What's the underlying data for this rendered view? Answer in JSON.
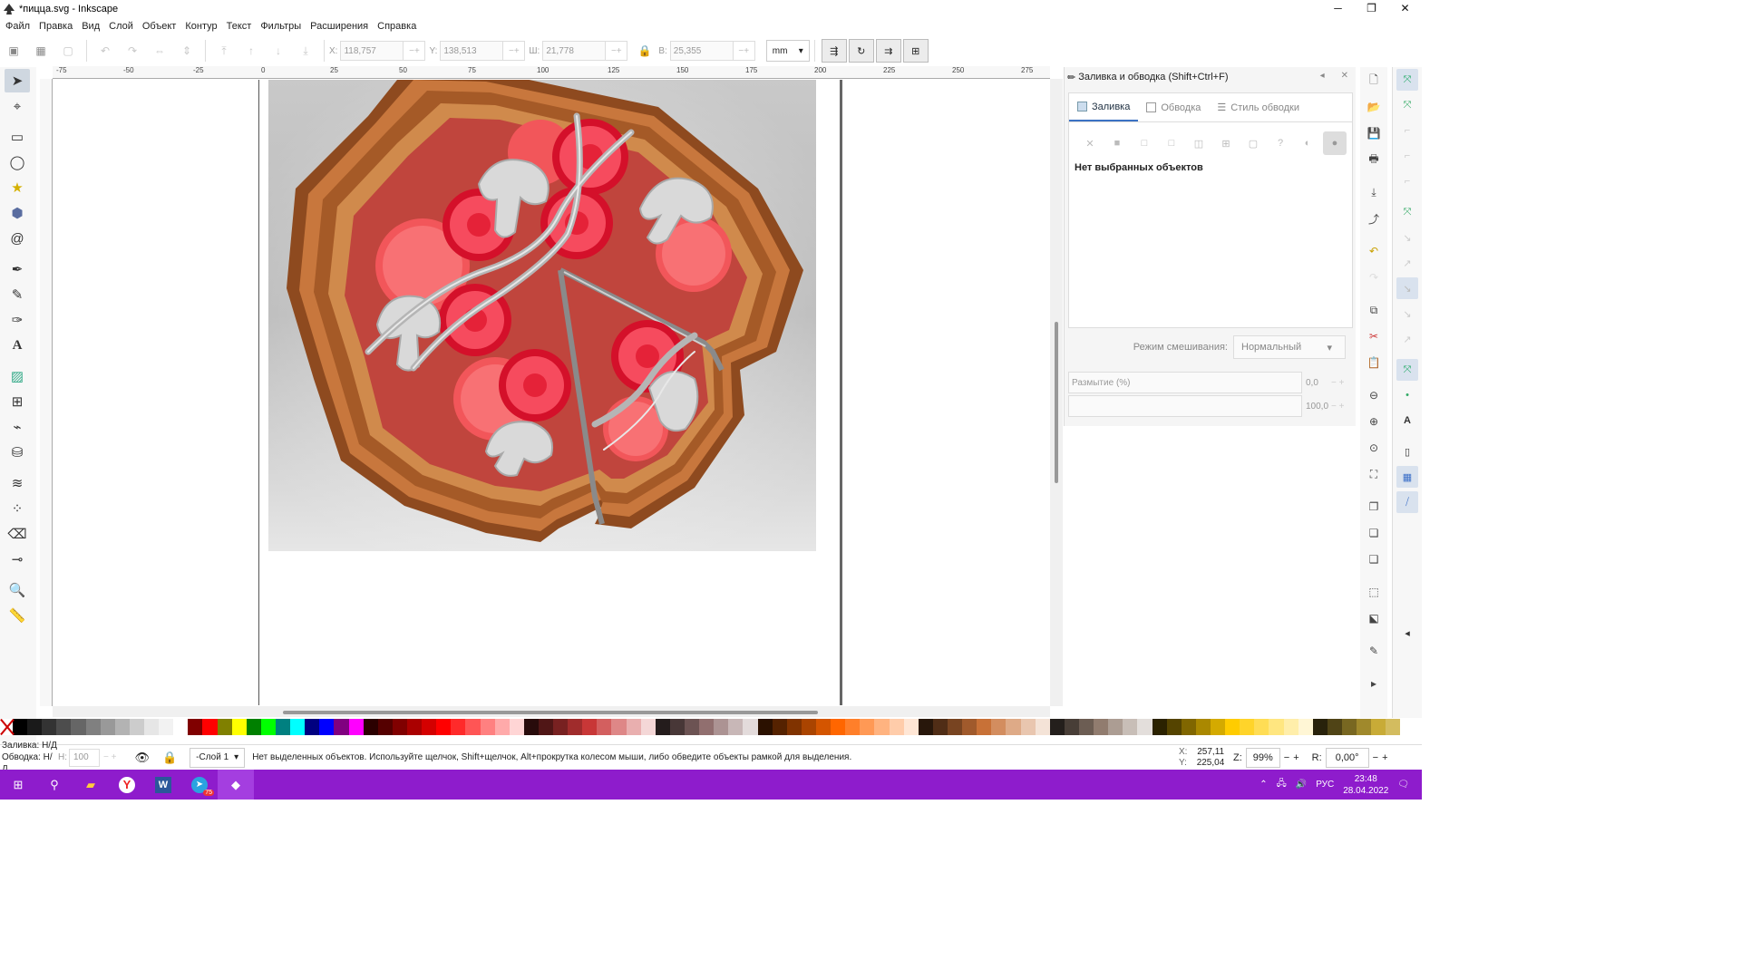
{
  "window": {
    "title": "*пицца.svg - Inkscape",
    "minimize": "─",
    "maximize": "❐",
    "close": "✕"
  },
  "menu": [
    "Файл",
    "Правка",
    "Вид",
    "Слой",
    "Объект",
    "Контур",
    "Текст",
    "Фильтры",
    "Расширения",
    "Справка"
  ],
  "toolbar": {
    "x_label": "X:",
    "x_value": "118,757",
    "y_label": "Y:",
    "y_value": "138,513",
    "w_label": "Ш:",
    "w_value": "21,778",
    "h_label": "В:",
    "h_value": "25,355",
    "unit": "mm"
  },
  "ruler": {
    "h_ticks": [
      "-75",
      "-50",
      "-25",
      "0",
      "25",
      "50",
      "75",
      "100",
      "125",
      "150",
      "175",
      "200",
      "225",
      "250",
      "275"
    ]
  },
  "dock": {
    "title": "Заливка и обводка (Shift+Ctrl+F)",
    "tabs": [
      "Заливка",
      "Обводка",
      "Стиль обводки"
    ],
    "no_selection": "Нет выбранных объектов",
    "blend_label": "Режим смешивания:",
    "blend_value": "Нормальный",
    "blur_label": "Размытие (%)",
    "blur_value": "0,0",
    "opacity_value": "100,0"
  },
  "palette": [
    "#000000",
    "#1a1a1a",
    "#333333",
    "#4d4d4d",
    "#666666",
    "#808080",
    "#999999",
    "#b3b3b3",
    "#cccccc",
    "#e6e6e6",
    "#f2f2f2",
    "#ffffff",
    "#800000",
    "#ff0000",
    "#808000",
    "#ffff00",
    "#008000",
    "#00ff00",
    "#008080",
    "#00ffff",
    "#000080",
    "#0000ff",
    "#800080",
    "#ff00ff",
    "#2b0000",
    "#550000",
    "#800000",
    "#aa0000",
    "#d40000",
    "#ff0000",
    "#ff2a2a",
    "#ff5555",
    "#ff8080",
    "#ffaaaa",
    "#ffd5d5",
    "#280b0b",
    "#501616",
    "#782121",
    "#a02c2c",
    "#c83737",
    "#d35f5f",
    "#de8787",
    "#e9afaf",
    "#f4d7d7",
    "#241c1c",
    "#483737",
    "#6c5353",
    "#916f6f",
    "#ac9393",
    "#c8b7b7",
    "#e3dbdb",
    "#2b1100",
    "#552200",
    "#803300",
    "#aa4400",
    "#d45500",
    "#ff6600",
    "#ff7f2a",
    "#ff9955",
    "#ffb380",
    "#ffccaa",
    "#ffe6d5",
    "#28170b",
    "#502d16",
    "#784421",
    "#a05a2c",
    "#c87137",
    "#d38d5f",
    "#deaa87",
    "#e9c6af",
    "#f4e3d7",
    "#241f1c",
    "#483e37",
    "#6c5d53",
    "#917c6f",
    "#ac9d93",
    "#c8beb7",
    "#e3dedb",
    "#2b2200",
    "#554400",
    "#806600",
    "#aa8800",
    "#d4aa00",
    "#ffcc00",
    "#ffd42a",
    "#ffdd55",
    "#ffe680",
    "#ffeeaa",
    "#fff6d5",
    "#28220b",
    "#504416",
    "#786721",
    "#a0892c",
    "#c8ab37",
    "#d3bc5f"
  ],
  "status": {
    "fill_label": "Заливка:",
    "fill_value": "Н/Д",
    "stroke_label": "Обводка:",
    "stroke_value": "Н/Д",
    "opacity_label": "Н:",
    "opacity_value": "100",
    "layer": "-Слой 1",
    "message": "Нет выделенных объектов. Используйте щелчок, Shift+щелчок, Alt+прокрутка колесом мыши, либо обведите объекты рамкой для выделения.",
    "x_label": "X:",
    "x_value": "257,11",
    "y_label": "Y:",
    "y_value": "225,04",
    "z_label": "Z:",
    "zoom": "99%",
    "r_label": "R:",
    "rotation": "0,00°"
  },
  "taskbar": {
    "lang": "РУС",
    "time": "23:48",
    "date": "28.04.2022",
    "telegram_badge": "75"
  }
}
